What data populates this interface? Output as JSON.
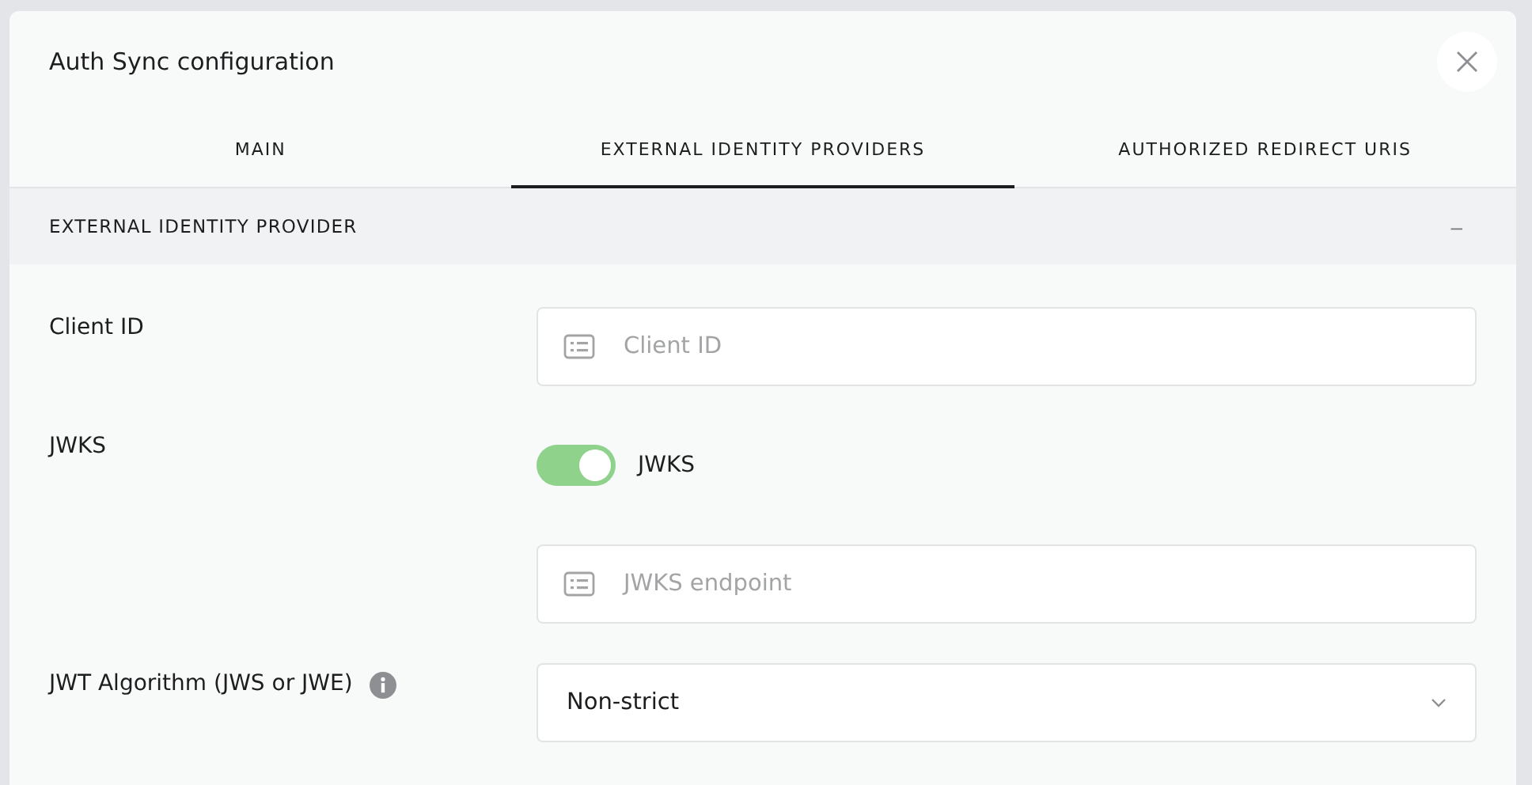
{
  "dialog": {
    "title": "Auth Sync configuration"
  },
  "tabs": [
    {
      "label": "MAIN",
      "selected": false
    },
    {
      "label": "EXTERNAL IDENTITY PROVIDERS",
      "selected": true
    },
    {
      "label": "AUTHORIZED REDIRECT URIS",
      "selected": false
    }
  ],
  "section": {
    "title": "EXTERNAL IDENTITY PROVIDER",
    "collapse": "–"
  },
  "fields": [
    {
      "kind": "text",
      "label": "Client ID",
      "placeholder": "Client ID"
    },
    {
      "kind": "toggle",
      "label": "JWKS",
      "toggle_label": "JWKS",
      "on": true
    },
    {
      "kind": "text",
      "placeholder": "JWKS endpoint"
    },
    {
      "kind": "select",
      "label": "JWT Algorithm (JWS or JWE)",
      "has_info": true,
      "value": "Non-strict"
    }
  ]
}
